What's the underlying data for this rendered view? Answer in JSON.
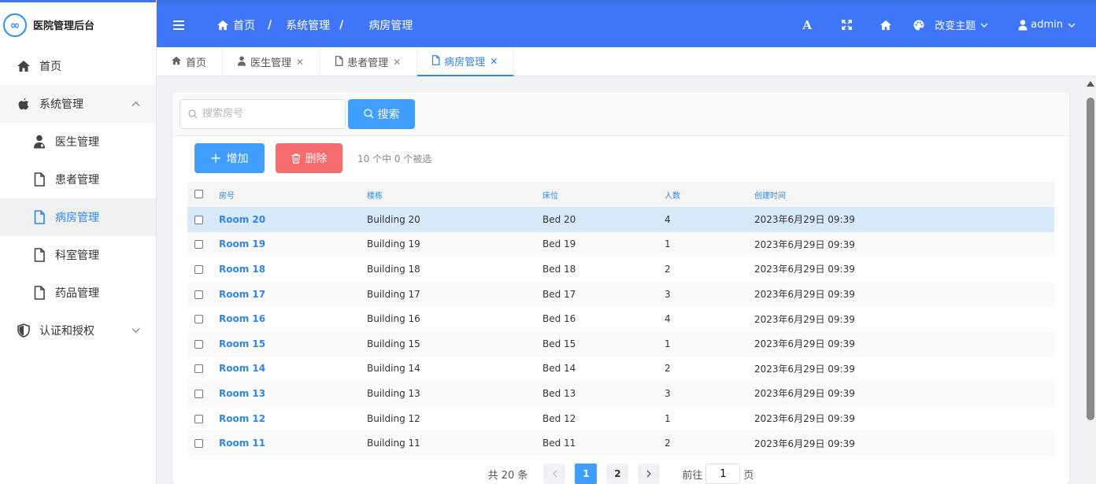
{
  "app": {
    "title": "医院管理后台",
    "logo_text": "∞"
  },
  "sidebar": {
    "items": [
      {
        "label": "首页",
        "icon": "home-icon"
      },
      {
        "label": "系统管理",
        "icon": "apple-icon"
      },
      {
        "label": "医生管理",
        "icon": "doctor-icon"
      },
      {
        "label": "患者管理",
        "icon": "file-icon"
      },
      {
        "label": "病房管理",
        "icon": "file-icon"
      },
      {
        "label": "科室管理",
        "icon": "file-icon"
      },
      {
        "label": "药品管理",
        "icon": "file-icon"
      },
      {
        "label": "认证和授权",
        "icon": "shield-icon"
      }
    ]
  },
  "header": {
    "breadcrumb": [
      "首页",
      "系统管理",
      "病房管理"
    ],
    "breadcrumb_sep": "/",
    "font_icon_label": "A",
    "theme_label": "改变主题",
    "user_label": "admin"
  },
  "tabs": [
    {
      "label": "首页",
      "icon": "home-icon"
    },
    {
      "label": "医生管理",
      "icon": "doctor-icon"
    },
    {
      "label": "患者管理",
      "icon": "file-icon"
    },
    {
      "label": "病房管理",
      "icon": "file-icon"
    }
  ],
  "search": {
    "placeholder": "搜索房号",
    "button_label": "搜索"
  },
  "toolbar": {
    "add_label": "增加",
    "delete_label": "删除",
    "selection_info": "10 个中 0 个被选"
  },
  "table": {
    "headers": [
      "房号",
      "楼栋",
      "床位",
      "人数",
      "创建时间"
    ],
    "rows": [
      [
        "Room 20",
        "Building 20",
        "Bed 20",
        "4",
        "2023年6月29日 09:39"
      ],
      [
        "Room 19",
        "Building 19",
        "Bed 19",
        "1",
        "2023年6月29日 09:39"
      ],
      [
        "Room 18",
        "Building 18",
        "Bed 18",
        "2",
        "2023年6月29日 09:39"
      ],
      [
        "Room 17",
        "Building 17",
        "Bed 17",
        "3",
        "2023年6月29日 09:39"
      ],
      [
        "Room 16",
        "Building 16",
        "Bed 16",
        "4",
        "2023年6月29日 09:39"
      ],
      [
        "Room 15",
        "Building 15",
        "Bed 15",
        "1",
        "2023年6月29日 09:39"
      ],
      [
        "Room 14",
        "Building 14",
        "Bed 14",
        "2",
        "2023年6月29日 09:39"
      ],
      [
        "Room 13",
        "Building 13",
        "Bed 13",
        "3",
        "2023年6月29日 09:39"
      ],
      [
        "Room 12",
        "Building 12",
        "Bed 12",
        "1",
        "2023年6月29日 09:39"
      ],
      [
        "Room 11",
        "Building 11",
        "Bed 11",
        "2",
        "2023年6月29日 09:39"
      ]
    ]
  },
  "pagination": {
    "total_label": "共 20 条",
    "pages": [
      "1",
      "2"
    ],
    "jump_prefix": "前往",
    "jump_value": "1",
    "jump_suffix": "页"
  },
  "colors": {
    "header_bg": "#3f76f7",
    "primary": "#409eff",
    "danger": "#f56c6c",
    "link": "#2f86ec",
    "highlight_row": "#d7e9fb"
  }
}
